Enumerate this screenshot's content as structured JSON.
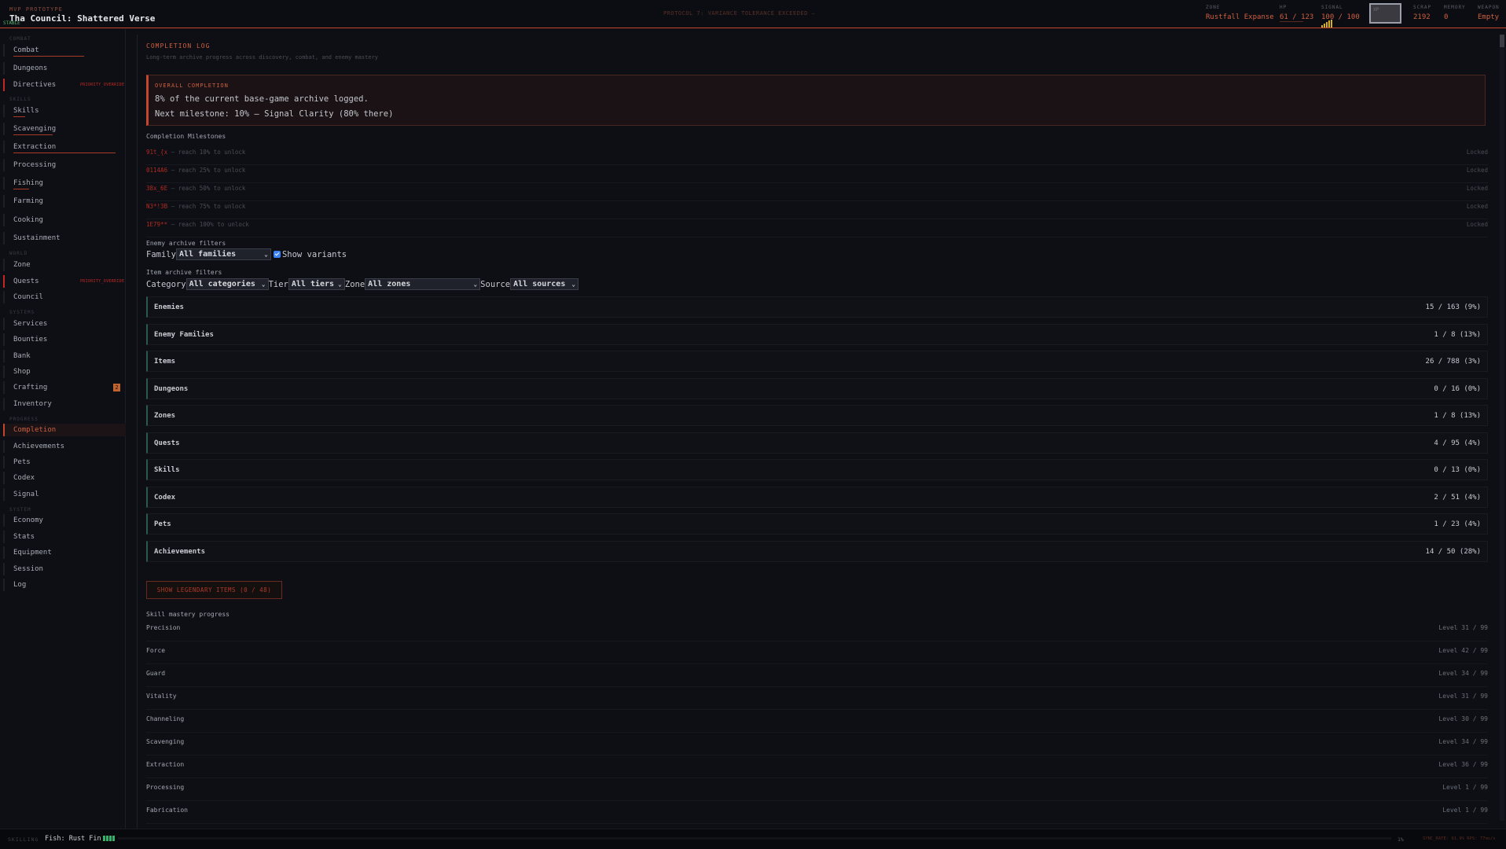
{
  "header": {
    "subtitle": "MVP PROTOTYPE",
    "title": "Tha Council: Shattered Verse",
    "tag": "STABLE",
    "protocol": "PROTOCOL 7: VARIANCE TOLERANCE EXCEEDED —",
    "stats": [
      {
        "label": "ZONE",
        "value": "Rustfall Expanse"
      },
      {
        "label": "HP",
        "value": "61 / 123"
      },
      {
        "label": "SIGNAL",
        "value": "100 / 100"
      },
      {
        "label": "SCRAP",
        "value": "2192"
      },
      {
        "label": "MEMORY",
        "value": "0"
      },
      {
        "label": "WEAPON",
        "value": "Empty"
      }
    ],
    "xp_label": "XP"
  },
  "sidebar": {
    "sections": [
      "COMBAT",
      "SKILLS",
      "WORLD",
      "SYSTEMS",
      "PROGRESS",
      "SYSTEM"
    ],
    "items": [
      {
        "label": "Combat"
      },
      {
        "label": "Dungeons"
      },
      {
        "label": "Directives",
        "warning": "PRIORITY_OVERRIDE"
      },
      {
        "label": "Skills"
      },
      {
        "label": "Scavenging"
      },
      {
        "label": "Extraction"
      },
      {
        "label": "Processing"
      },
      {
        "label": "Fishing"
      },
      {
        "label": "Farming"
      },
      {
        "label": "Cooking"
      },
      {
        "label": "Sustainment"
      },
      {
        "label": "Zone"
      },
      {
        "label": "Quests",
        "warning": "PRIORITY_OVERRIDE"
      },
      {
        "label": "Council"
      },
      {
        "label": "Services"
      },
      {
        "label": "Bounties"
      },
      {
        "label": "Bank"
      },
      {
        "label": "Shop"
      },
      {
        "label": "Crafting",
        "badge": "2"
      },
      {
        "label": "Inventory"
      },
      {
        "label": "Completion"
      },
      {
        "label": "Achievements"
      },
      {
        "label": "Pets"
      },
      {
        "label": "Codex"
      },
      {
        "label": "Signal"
      },
      {
        "label": "Economy"
      },
      {
        "label": "Stats"
      },
      {
        "label": "Equipment"
      },
      {
        "label": "Session"
      },
      {
        "label": "Log"
      }
    ]
  },
  "main": {
    "title": "COMPLETION LOG",
    "subtitle": "Long-term archive progress across discovery, combat, and enemy mastery",
    "overall": {
      "label": "OVERALL COMPLETION",
      "line1": "8% of the current base-game archive logged.",
      "line2": "Next milestone: 10% — Signal Clarity (80% there)"
    },
    "milestones_title": "Completion Milestones",
    "milestones": [
      {
        "code": "91t_{x",
        "desc": " — reach 10% to unlock",
        "state": "Locked"
      },
      {
        "code": "0114A6",
        "desc": " — reach 25% to unlock",
        "state": "Locked"
      },
      {
        "code": "38x_6E",
        "desc": " — reach 50% to unlock",
        "state": "Locked"
      },
      {
        "code": "N3*!3B",
        "desc": " — reach 75% to unlock",
        "state": "Locked"
      },
      {
        "code": "1E79**",
        "desc": " — reach 100% to unlock",
        "state": "Locked"
      }
    ],
    "enemy_filters": {
      "title": "Enemy archive filters",
      "family_label": "Family",
      "family_value": "All families",
      "variants_label": "Show variants"
    },
    "item_filters": {
      "title": "Item archive filters",
      "category_label": "Category",
      "category_value": "All categories",
      "tier_label": "Tier",
      "tier_value": "All tiers",
      "zone_label": "Zone",
      "zone_value": "All zones",
      "source_label": "Source",
      "source_value": "All sources"
    },
    "categories": [
      {
        "name": "Enemies",
        "count": "15 / 163 (9%)"
      },
      {
        "name": "Enemy Families",
        "count": "1 / 8 (13%)"
      },
      {
        "name": "Items",
        "count": "26 / 788 (3%)"
      },
      {
        "name": "Dungeons",
        "count": "0 / 16 (0%)"
      },
      {
        "name": "Zones",
        "count": "1 / 8 (13%)"
      },
      {
        "name": "Quests",
        "count": "4 / 95 (4%)"
      },
      {
        "name": "Skills",
        "count": "0 / 13 (0%)"
      },
      {
        "name": "Codex",
        "count": "2 / 51 (4%)"
      },
      {
        "name": "Pets",
        "count": "1 / 23 (4%)"
      },
      {
        "name": "Achievements",
        "count": "14 / 50 (28%)"
      }
    ],
    "legendary_button": "SHOW LEGENDARY ITEMS (0 / 48)",
    "mastery_title": "Skill mastery progress",
    "skills": [
      {
        "name": "Precision",
        "level": "Level 31 / 99"
      },
      {
        "name": "Force",
        "level": "Level 42 / 99"
      },
      {
        "name": "Guard",
        "level": "Level 34 / 99"
      },
      {
        "name": "Vitality",
        "level": "Level 31 / 99"
      },
      {
        "name": "Channeling",
        "level": "Level 30 / 99"
      },
      {
        "name": "Scavenging",
        "level": "Level 34 / 99"
      },
      {
        "name": "Extraction",
        "level": "Level 36 / 99"
      },
      {
        "name": "Processing",
        "level": "Level 1 / 99"
      },
      {
        "name": "Fabrication",
        "level": "Level 1 / 99"
      }
    ]
  },
  "footer": {
    "label": "SKILLING",
    "activity": "Fish: Rust Fin",
    "percent": "1%",
    "sync": "SYNC_RATE: 91.9%   RPS: 77ms/s"
  },
  "colors": {
    "accent": "#c4462c",
    "alert": "#c02a22",
    "signal": "#d4b022",
    "progress": "#33b36a"
  }
}
